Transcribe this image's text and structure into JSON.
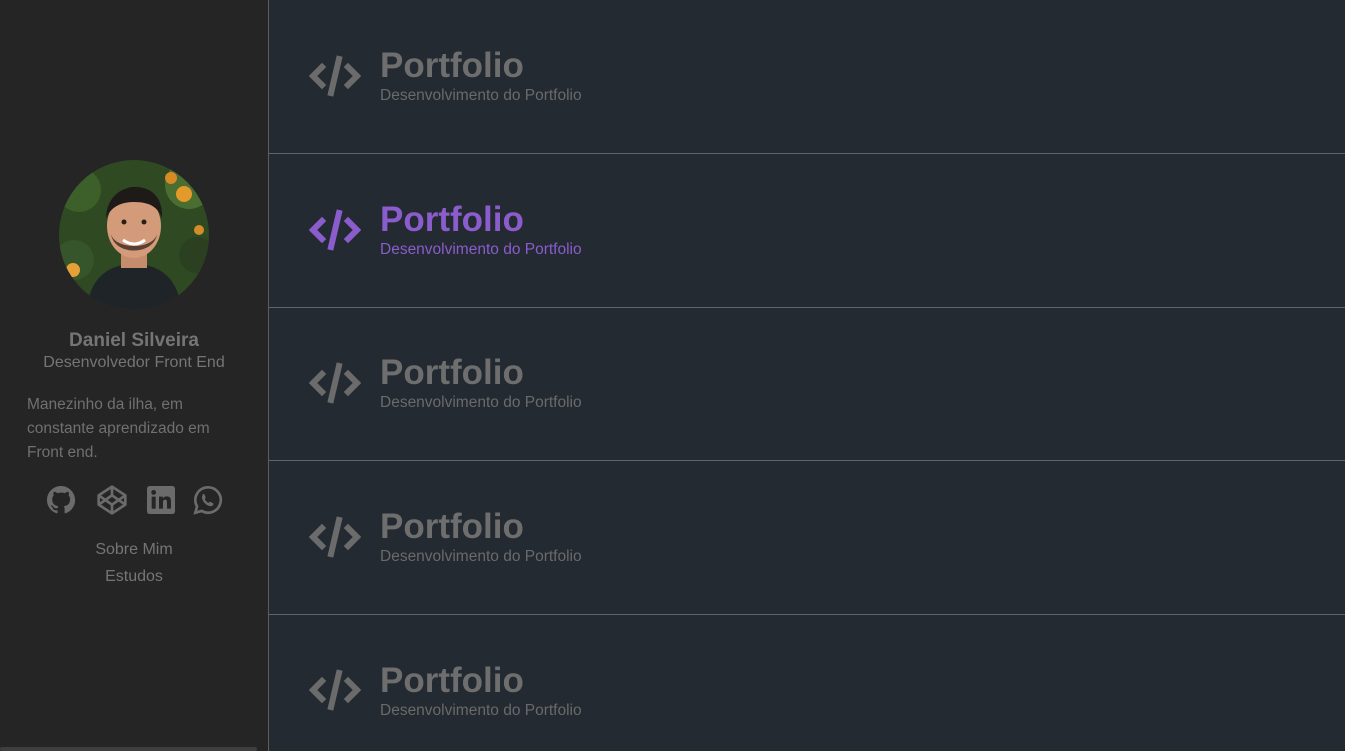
{
  "profile": {
    "name": "Daniel Silveira",
    "role": "Desenvolvedor Front End",
    "bio": "Manezinho da ilha, em constante aprendizado em Front end."
  },
  "social_links": [
    {
      "icon": "github-icon"
    },
    {
      "icon": "codepen-icon"
    },
    {
      "icon": "linkedin-icon"
    },
    {
      "icon": "whatsapp-icon"
    }
  ],
  "nav": {
    "items": [
      {
        "label": "Sobre Mim"
      },
      {
        "label": "Estudos"
      }
    ]
  },
  "projects": [
    {
      "title": "Portfolio",
      "subtitle": "Desenvolvimento do Portfolio",
      "icon": "code-icon",
      "active": false
    },
    {
      "title": "Portfolio",
      "subtitle": "Desenvolvimento do Portfolio",
      "icon": "code-icon",
      "active": true
    },
    {
      "title": "Portfolio",
      "subtitle": "Desenvolvimento do Portfolio",
      "icon": "code-icon",
      "active": false
    },
    {
      "title": "Portfolio",
      "subtitle": "Desenvolvimento do Portfolio",
      "icon": "code-icon",
      "active": false
    },
    {
      "title": "Portfolio",
      "subtitle": "Desenvolvimento do Portfolio",
      "icon": "code-icon",
      "active": false
    }
  ],
  "colors": {
    "sidebar_bg": "#252525",
    "main_bg": "#232a31",
    "muted_text": "#6e6e6e",
    "accent": "#8a5ccc"
  }
}
